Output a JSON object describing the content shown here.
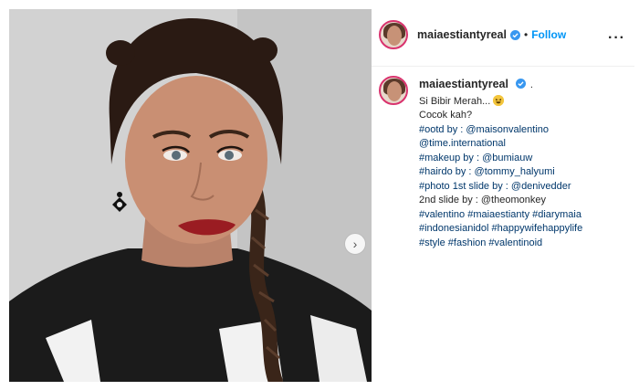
{
  "post": {
    "username": "maiaestiantyreal",
    "header_separator": "•",
    "follow_label": "Follow",
    "more_label": "···",
    "caption_suffix": ".",
    "caption_lines": [
      {
        "text": "Si Bibir Merah...",
        "is_tag": false,
        "emoji": "laughing-face"
      },
      {
        "text": "Cocok kah?",
        "is_tag": false
      },
      {
        "text": "#ootd by : @maisonvalentino",
        "is_tag": true
      },
      {
        "text": "@time.international",
        "is_tag": true
      },
      {
        "text": "#makeup by : @bumiauw",
        "is_tag": true
      },
      {
        "text": "#hairdo by : @tommy_halyumi",
        "is_tag": true
      },
      {
        "text": "#photo 1st slide by : @denivedder",
        "is_tag": true
      },
      {
        "text": "2nd slide by : @theomonkey",
        "is_tag": false
      },
      {
        "text": "#valentino #maiaestianty #diarymaia",
        "is_tag": true
      },
      {
        "text": "#indonesianidol #happywifehappylife",
        "is_tag": true
      },
      {
        "text": "#style #fashion #valentinoid",
        "is_tag": true
      }
    ]
  },
  "icons": {
    "next": "chevron-right-icon",
    "verified": "verified-badge-icon",
    "more": "more-options-icon"
  },
  "colors": {
    "link_blue": "#0095f6",
    "tag_blue": "#00376b",
    "story_ring": "#d9336e",
    "text": "#262626"
  }
}
